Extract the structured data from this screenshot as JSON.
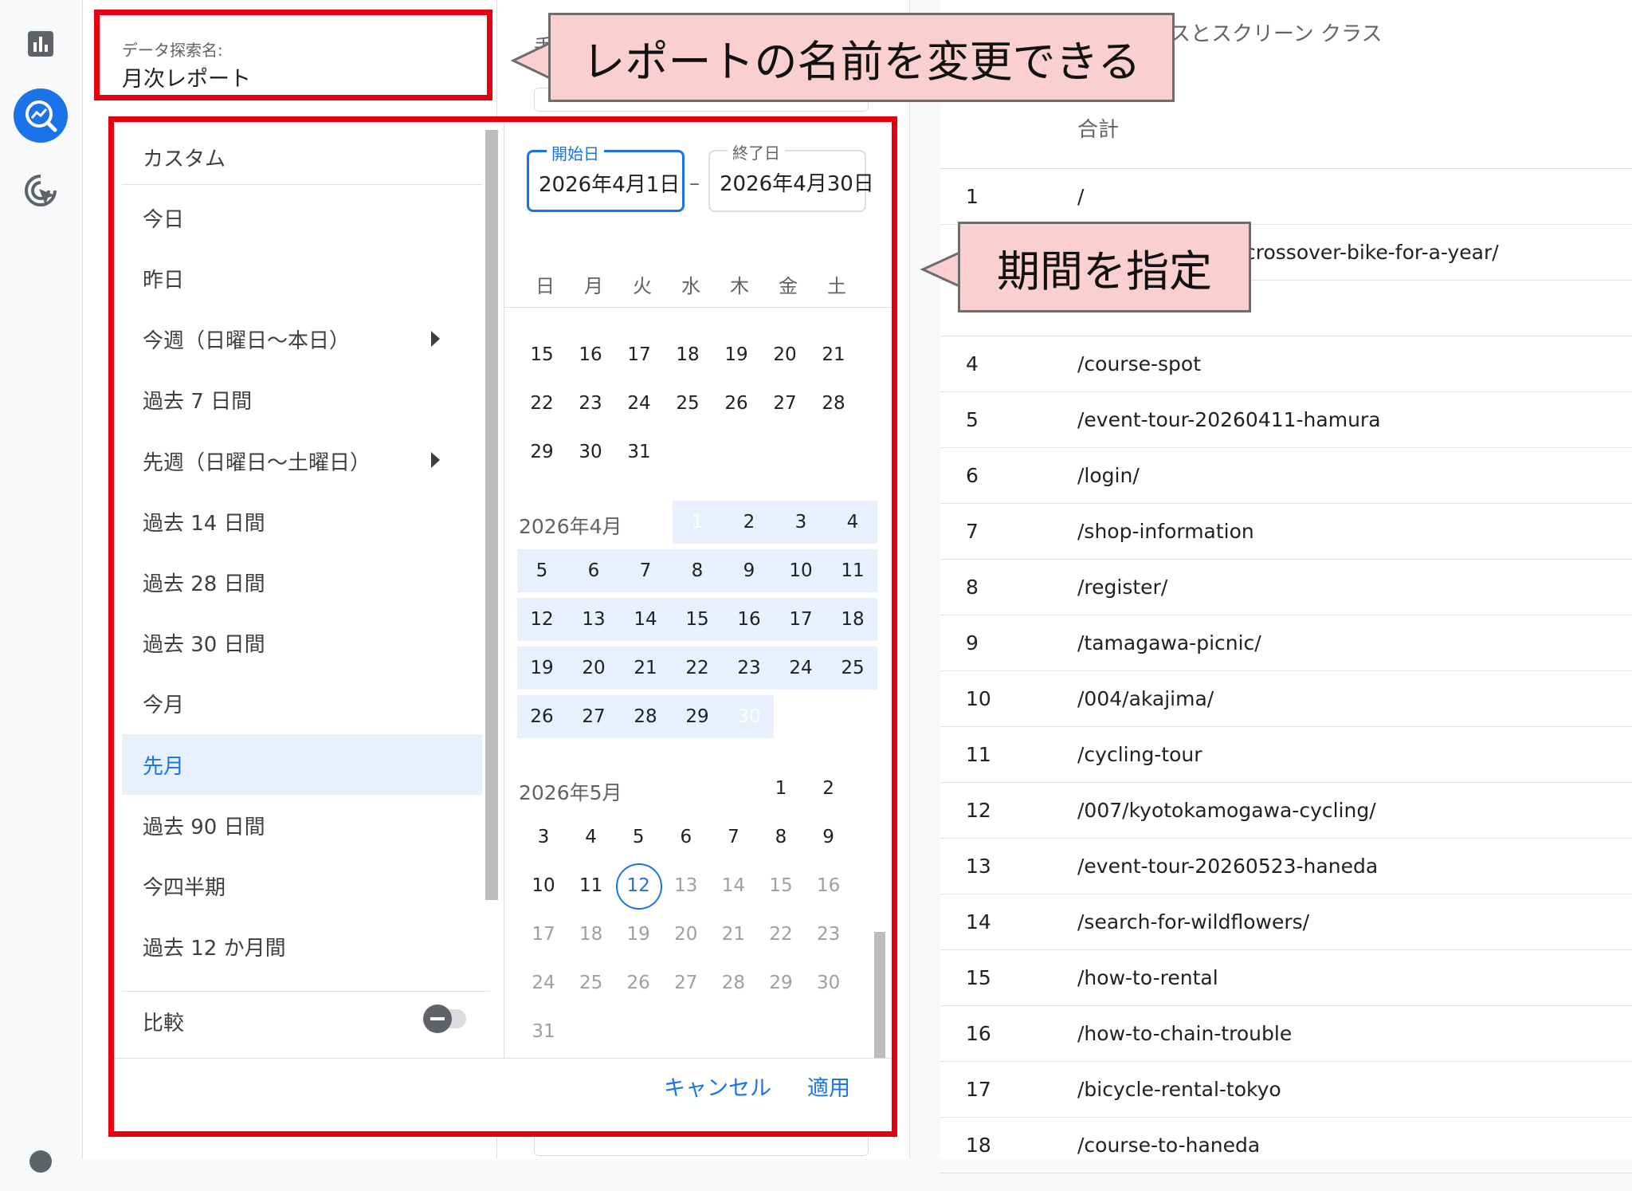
{
  "rail": {
    "icons": [
      "bar-chart-icon",
      "explore-icon",
      "advertising-icon"
    ]
  },
  "name_field": {
    "label": "データ探索名:",
    "value": "月次レポート"
  },
  "callouts": {
    "rename": "レポートの名前を変更できる",
    "period": "期間を指定"
  },
  "background_text": {
    "tab_fragment": "手",
    "report_header_fragment": "スとスクリーン クラス",
    "total_label": "合計",
    "row2_fragment": "crossover-bike-for-a-year/"
  },
  "presets": [
    {
      "label": "カスタム",
      "submenu": false,
      "selected": false
    },
    {
      "label": "今日",
      "submenu": false,
      "selected": false
    },
    {
      "label": "昨日",
      "submenu": false,
      "selected": false
    },
    {
      "label": "今週（日曜日〜本日）",
      "submenu": true,
      "selected": false
    },
    {
      "label": "過去 7 日間",
      "submenu": false,
      "selected": false
    },
    {
      "label": "先週（日曜日〜土曜日）",
      "submenu": true,
      "selected": false
    },
    {
      "label": "過去 14 日間",
      "submenu": false,
      "selected": false
    },
    {
      "label": "過去 28 日間",
      "submenu": false,
      "selected": false
    },
    {
      "label": "過去 30 日間",
      "submenu": false,
      "selected": false
    },
    {
      "label": "今月",
      "submenu": false,
      "selected": false
    },
    {
      "label": "先月",
      "submenu": false,
      "selected": true
    },
    {
      "label": "過去 90 日間",
      "submenu": false,
      "selected": false
    },
    {
      "label": "今四半期",
      "submenu": false,
      "selected": false
    },
    {
      "label": "過去 12 か月間",
      "submenu": false,
      "selected": false
    }
  ],
  "compare": {
    "label": "比較",
    "enabled": false
  },
  "start_date": {
    "label": "開始日",
    "value": "2026年4月1日"
  },
  "end_date": {
    "label": "終了日",
    "value": "2026年4月30日"
  },
  "weekdays": [
    "日",
    "月",
    "火",
    "水",
    "木",
    "金",
    "土"
  ],
  "march_tail": [
    [
      15,
      16,
      17,
      18,
      19,
      20,
      21
    ],
    [
      22,
      23,
      24,
      25,
      26,
      27,
      28
    ],
    [
      29,
      30,
      31
    ]
  ],
  "april": {
    "label": "2026年4月",
    "weeks": [
      [
        null,
        null,
        null,
        1,
        2,
        3,
        4
      ],
      [
        5,
        6,
        7,
        8,
        9,
        10,
        11
      ],
      [
        12,
        13,
        14,
        15,
        16,
        17,
        18
      ],
      [
        19,
        20,
        21,
        22,
        23,
        24,
        25
      ],
      [
        26,
        27,
        28,
        29,
        30
      ]
    ],
    "range_start": 1,
    "range_end": 30
  },
  "may": {
    "label": "2026年5月",
    "weeks": [
      [
        null,
        null,
        null,
        null,
        null,
        1,
        2
      ],
      [
        3,
        4,
        5,
        6,
        7,
        8,
        9
      ],
      [
        10,
        11,
        12,
        13,
        14,
        15,
        16
      ],
      [
        17,
        18,
        19,
        20,
        21,
        22,
        23
      ],
      [
        24,
        25,
        26,
        27,
        28,
        29,
        30
      ],
      [
        31
      ]
    ],
    "today": 12,
    "last_enabled": 12
  },
  "buttons": {
    "cancel": "キャンセル",
    "apply": "適用"
  },
  "report_rows": [
    {
      "n": "1",
      "path": "/"
    },
    {
      "n": "4",
      "path": "/course-spot"
    },
    {
      "n": "5",
      "path": "/event-tour-20260411-hamura"
    },
    {
      "n": "6",
      "path": "/login/"
    },
    {
      "n": "7",
      "path": "/shop-information"
    },
    {
      "n": "8",
      "path": "/register/"
    },
    {
      "n": "9",
      "path": "/tamagawa-picnic/"
    },
    {
      "n": "10",
      "path": "/004/akajima/"
    },
    {
      "n": "11",
      "path": "/cycling-tour"
    },
    {
      "n": "12",
      "path": "/007/kyotokamogawa-cycling/"
    },
    {
      "n": "13",
      "path": "/event-tour-20260523-haneda"
    },
    {
      "n": "14",
      "path": "/search-for-wildflowers/"
    },
    {
      "n": "15",
      "path": "/how-to-rental"
    },
    {
      "n": "16",
      "path": "/how-to-chain-trouble"
    },
    {
      "n": "17",
      "path": "/bicycle-rental-tokyo"
    },
    {
      "n": "18",
      "path": "/course-to-haneda"
    }
  ],
  "colors": {
    "highlight_red": "#e60012",
    "accent_blue": "#1a73e8",
    "range_bg": "#e8f0fe",
    "callout_bg": "#f9cfcf"
  }
}
